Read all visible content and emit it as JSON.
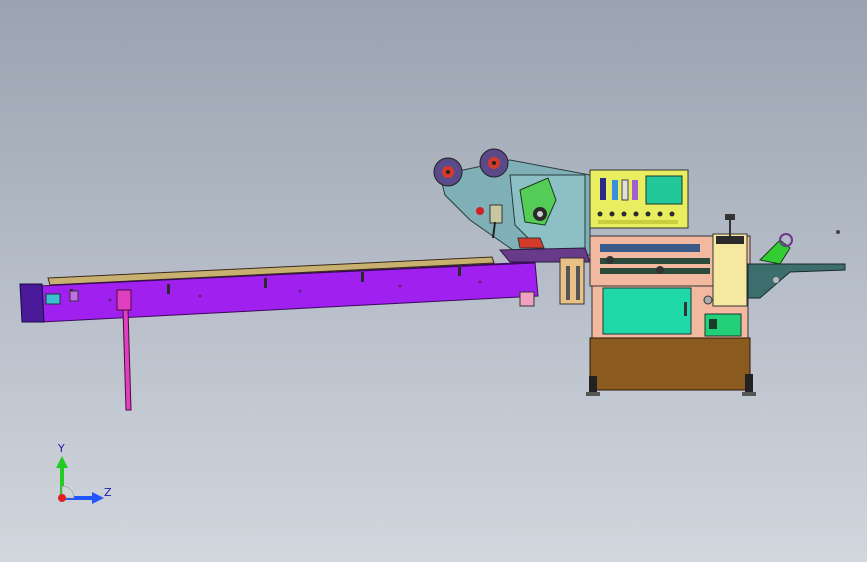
{
  "viewport": {
    "background_top": "#9aa3b0",
    "background_bottom": "#d2d6dd"
  },
  "model": {
    "parts": {
      "infeed_conveyor": {
        "color": "#a020f0"
      },
      "conveyor_end_cap": {
        "color": "#4b1a9a"
      },
      "support_leg": {
        "color": "#e040c0"
      },
      "film_unwind_frame": {
        "color": "#7fb0b8"
      },
      "film_rollers": {
        "color": "#5a4a8a"
      },
      "control_panel": {
        "color": "#e8ee60"
      },
      "control_screen": {
        "color": "#22c89a"
      },
      "main_cabinet_lower": {
        "color": "#8a5a1e"
      },
      "main_cabinet_upper": {
        "color": "#f2b8a0"
      },
      "cabinet_door": {
        "color": "#1fd8a8"
      },
      "sealing_unit": {
        "color": "#f6e8a0"
      },
      "outfeed_conveyor": {
        "color": "#3d6e6e"
      },
      "green_cutter_head": {
        "color": "#33cc33"
      }
    }
  },
  "triad": {
    "y_label": "Y",
    "z_label": "Z",
    "y_color": "#22cc22",
    "z_color": "#2255ff",
    "origin_color": "#e02020"
  }
}
